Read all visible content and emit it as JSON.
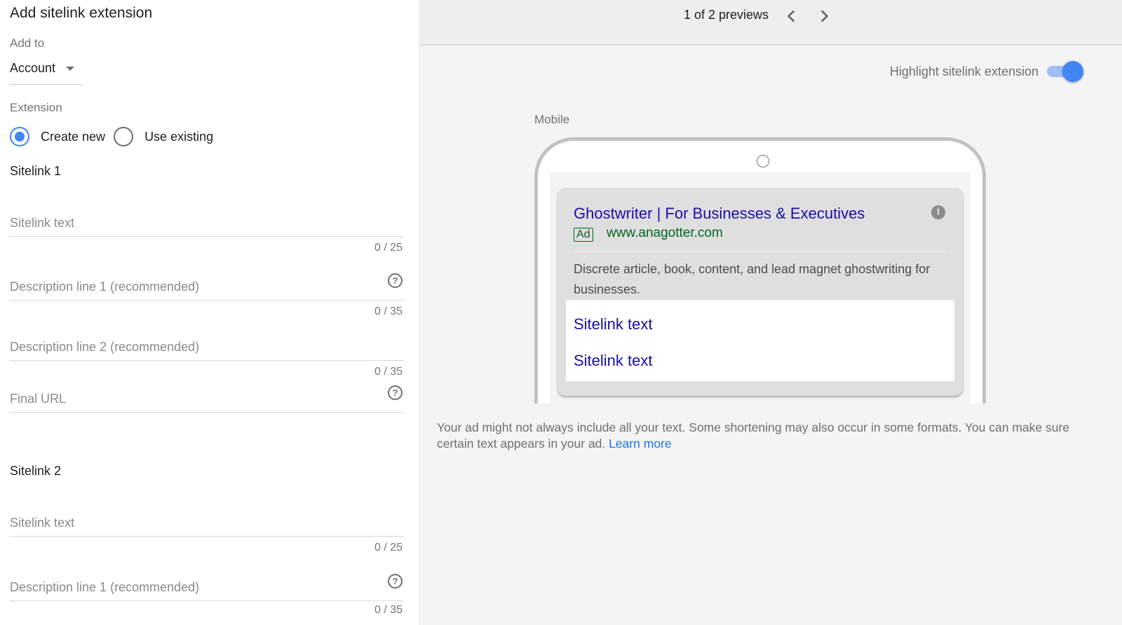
{
  "form": {
    "title": "Add sitelink extension",
    "add_to_label": "Add to",
    "add_to_value": "Account",
    "extension_label": "Extension",
    "radio_create_new": "Create new",
    "radio_use_existing": "Use existing",
    "selected_option": "Create new",
    "sitelinks": [
      {
        "heading": "Sitelink 1",
        "text_placeholder": "Sitelink text",
        "text_value": "",
        "text_counter": "0 / 25",
        "desc1_placeholder": "Description line 1 (recommended)",
        "desc1_value": "",
        "desc1_counter": "0 / 35",
        "desc2_placeholder": "Description line 2 (recommended)",
        "desc2_value": "",
        "desc2_counter": "0 / 35",
        "url_placeholder": "Final URL",
        "url_value": ""
      },
      {
        "heading": "Sitelink 2",
        "text_placeholder": "Sitelink text",
        "text_value": "",
        "text_counter": "0 / 25",
        "desc1_placeholder": "Description line 1 (recommended)",
        "desc1_value": "",
        "desc1_counter": "0 / 35"
      }
    ],
    "help_icon": "question-circle-icon"
  },
  "preview": {
    "pager_text": "1 of 2 previews",
    "prev_icon": "chevron-left-icon",
    "next_icon": "chevron-right-icon",
    "highlight_label": "Highlight sitelink extension",
    "highlight_on": true,
    "device_label": "Mobile",
    "ad": {
      "headline": "Ghostwriter | For Businesses & Executives",
      "badge": "Ad",
      "display_url": "www.anagotter.com",
      "description": "Discrete article, book, content, and lead magnet ghostwriting for businesses.",
      "info_icon": "info-icon",
      "sitelinks": [
        "Sitelink text",
        "Sitelink text"
      ]
    },
    "disclaimer": "Your ad might not always include all your text. Some shortening may also occur in some formats. You can make sure certain text appears in your ad.",
    "learn_more": "Learn more"
  },
  "colors": {
    "accent": "#4285f4",
    "ad_headline": "#1a0dab",
    "ad_url": "#006621",
    "link": "#1a73e8"
  }
}
